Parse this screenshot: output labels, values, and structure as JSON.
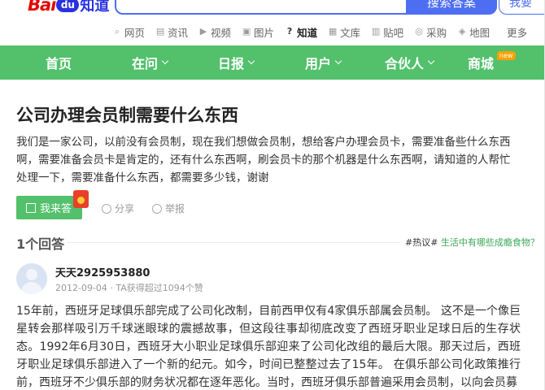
{
  "header": {
    "logo_bai": "Bai",
    "logo_paw": "du",
    "logo_zd": "知道",
    "search_button": "搜索答案",
    "ask_button": "我要"
  },
  "channels": [
    {
      "label": "网页",
      "icon": "search-icon"
    },
    {
      "label": "资讯",
      "icon": "news-icon"
    },
    {
      "label": "视频",
      "icon": "video-icon"
    },
    {
      "label": "图片",
      "icon": "image-icon"
    },
    {
      "label": "知道",
      "icon": "question-icon",
      "active": true
    },
    {
      "label": "文库",
      "icon": "doc-icon"
    },
    {
      "label": "贴吧",
      "icon": "tieba-icon"
    },
    {
      "label": "采购",
      "icon": "purchase-icon"
    },
    {
      "label": "地图",
      "icon": "map-icon"
    },
    {
      "label": "更多"
    }
  ],
  "nav": {
    "items": [
      {
        "label": "首页",
        "dropdown": false
      },
      {
        "label": "在问",
        "dropdown": true
      },
      {
        "label": "日报",
        "dropdown": true
      },
      {
        "label": "用户",
        "dropdown": true
      },
      {
        "label": "合伙人",
        "dropdown": true
      },
      {
        "label": "商城",
        "dropdown": false
      }
    ],
    "new_badge": "new",
    "color": "#53c06c"
  },
  "question": {
    "title": "公司办理会员制需要什么东西",
    "description": "我们是一家公司，以前没有会员制，现在我们想做会员制，想给客户办理会员卡，需要准备些什么东西啊，需要准备会员卡是肯定的，还有什么东西啊，刷会员卡的那个机器是什么东西啊，请知道的人帮忙处理一下，需要准备什么东西，都需要多少钱，谢谢",
    "answer_button": "我来答",
    "share": "分享",
    "report": "举报"
  },
  "answers": {
    "count": "1个回答",
    "topic_prefix": "#热议#",
    "topic_text": "生活中有哪些成瘾食物？",
    "items": [
      {
        "username": "天天2925953880",
        "meta": "2012-09-04 · TA获得超过1094个赞",
        "text": "15年前，西班牙足球俱乐部完成了公司化改制，目前西甲仅有4家俱乐部属会员制。 这不是一个像巨星转会那样吸引万千球迷眼球的震撼故事，但这段往事却彻底改变了西班牙职业足球日后的生存状态。1992年6月30日，西班牙大小职业足球俱乐部迎来了公司化改组的最后大限。那天过后，西班牙职业足球俱乐部进入了一个新的纪元。如今，时间已整整过去了15年。 在俱乐部公司化政策推行前，西班牙不少俱乐部的财务状况都在逐年恶化。当时，西班牙俱乐部普遍采用会员制，以向会员募"
      }
    ]
  }
}
